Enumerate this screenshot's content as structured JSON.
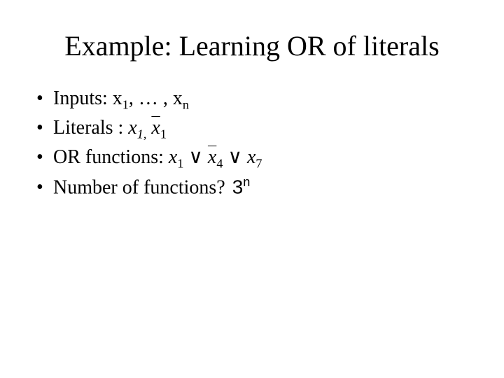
{
  "title": "Example: Learning OR of literals",
  "bullets": {
    "b1": {
      "prefix": "Inputs: x",
      "sub1": "1",
      "mid": ", … , x",
      "sub2": "n"
    },
    "b2": {
      "prefix": "Literals : ",
      "lit_var": "x",
      "lit_sub": "1,",
      "lit_var2": "x",
      "lit_sub2": "1"
    },
    "b3": {
      "prefix": "OR functions:",
      "t1_var": "x",
      "t1_sub": "1",
      "or": "∨",
      "t2_var": "x",
      "t2_sub": "4",
      "t3_var": "x",
      "t3_sub": "7"
    },
    "b4": {
      "prefix": "Number of functions?",
      "ans_base": "3",
      "ans_exp": "n"
    }
  }
}
